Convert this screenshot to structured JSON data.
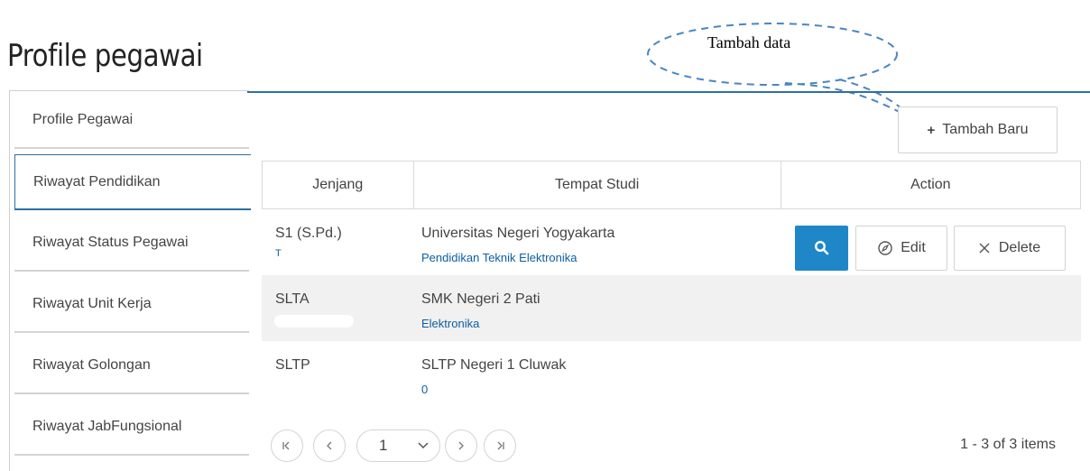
{
  "page": {
    "title": "Profile pegawai"
  },
  "annotation": {
    "callout_text": "Tambah data"
  },
  "sidebar": {
    "items": [
      {
        "label": "Profile Pegawai"
      },
      {
        "label": "Riwayat Pendidikan",
        "active": true
      },
      {
        "label": "Riwayat Status Pegawai"
      },
      {
        "label": "Riwayat Unit Kerja"
      },
      {
        "label": "Riwayat Golongan"
      },
      {
        "label": "Riwayat JabFungsional"
      }
    ]
  },
  "toolbar": {
    "add_label": "Tambah Baru",
    "add_icon": "plus-icon"
  },
  "grid": {
    "columns": [
      "Jenjang",
      "Tempat Studi",
      "Action"
    ],
    "rows": [
      {
        "jenjang": "S1 (S.Pd.)",
        "sub": "T",
        "tempat": "Universitas Negeri Yogyakarta",
        "prodi": "Pendidikan Teknik Elektronika"
      },
      {
        "jenjang": "SLTA",
        "sub": "",
        "tempat": "SMK Negeri 2 Pati",
        "prodi": "Elektronika"
      },
      {
        "jenjang": "SLTP",
        "sub": "",
        "tempat": "SLTP Negeri 1 Cluwak",
        "prodi": "0"
      }
    ],
    "actions": {
      "view_icon": "search-icon",
      "edit_label": "Edit",
      "delete_label": "Delete"
    }
  },
  "pager": {
    "first_icon": "first-page-icon",
    "prev_icon": "prev-page-icon",
    "next_icon": "next-page-icon",
    "last_icon": "last-page-icon",
    "current_page": "1",
    "info": "1 - 3 of 3 items"
  },
  "colors": {
    "accent": "#2d6fa3",
    "primary_button": "#1f87c8",
    "link": "#0d5fa0",
    "alt_row": "#f1f1f1"
  }
}
